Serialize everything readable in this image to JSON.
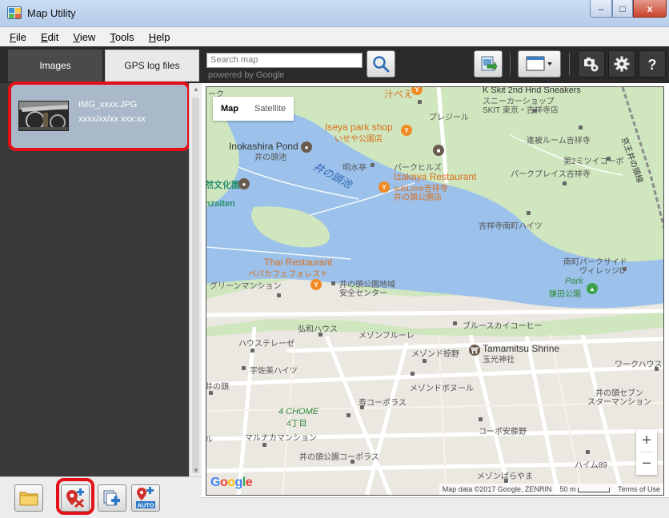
{
  "window": {
    "title": "Map Utility",
    "minimize": "–",
    "maximize": "□",
    "close": "x"
  },
  "menu": [
    {
      "label": "File",
      "u": "F",
      "rest": "ile"
    },
    {
      "label": "Edit",
      "u": "E",
      "rest": "dit"
    },
    {
      "label": "View",
      "u": "V",
      "rest": "iew"
    },
    {
      "label": "Tools",
      "u": "T",
      "rest": "ools"
    },
    {
      "label": "Help",
      "u": "H",
      "rest": "elp"
    }
  ],
  "tabs": {
    "images": "Images",
    "gps": "GPS log files"
  },
  "search": {
    "placeholder": "Search map",
    "powered_by": "powered by Google"
  },
  "image_list": [
    {
      "name": "IMG_xxxx.JPG",
      "datetime": "xxxx/xx/xx xxx:xx"
    }
  ],
  "bottom_buttons": {
    "auto_label": "AUTO"
  },
  "map": {
    "type_map": "Map",
    "type_satellite": "Satellite",
    "zoom_in": "+",
    "zoom_out": "−",
    "logo": "Google",
    "attribution": "Map data ©2017 Google, ZENRIN",
    "scale": "50 m",
    "terms": "Terms of Use",
    "labels": {
      "sneakers": "K Skit 2nd Hnd Sneakers",
      "sneakers_jp": "スニーカーショップ",
      "sneakers_jp2": "SKIT 東京・吉祥寺店",
      "pregio": "プレジール",
      "iseya": "Iseya park shop",
      "iseya_jp": "いせや公園店",
      "shindo": "進被ルーム吉祥寺",
      "inokashira_pond": "Inokashira Pond",
      "inokashira_pond_jp": "井の頭池",
      "meisuitei": "明水亭",
      "park_hills": "パークヒルズ",
      "mitsui": "第2ミツイコーポ",
      "park_place": "パークプレイス吉祥寺",
      "izakaya": "Izakaya Restaurant",
      "izakaya_sub": "subLime吉祥寺",
      "izakaya_jp": "井の頭公園店",
      "pond_big": "井の頭池",
      "nature_center": "然文化園",
      "zaiten": "nzaiten",
      "kichijoji_heights": "吉祥寺南町ハイツ",
      "thai": "Thai Restaurant",
      "thai_jp": "ペパカフェフォレスト",
      "green_mansion": "グリーンマンション",
      "safety_center": "井の頭公園地域",
      "safety_center2": "安全センター",
      "minamicho_side": "南町パークサイド",
      "village_d": "ヴィレッジD",
      "park": "Park",
      "kamata_park": "鎌田公園",
      "blue_sky": "ブルースカイコーヒー",
      "kowa_house": "弘和ハウス",
      "maison_flure": "メゾンフルーレ",
      "house_tele": "ハウステレーゼ",
      "maison_tsubaki": "メゾンド椋野",
      "tamamitsu": "Tamamitsu Shrine",
      "tamamitsu_jp": "玉光神社",
      "work_house": "ワークハウス",
      "usami_heights": "宇佐美ハイツ",
      "inokashira_left": "井の頭",
      "maison_borneur": "メゾンドボヌール",
      "seven_star": "井の頭セブン",
      "seven_star2": "スターマンション",
      "kotobuki": "寿コーポラス",
      "chome": "4 CHOME",
      "chome_jp": "4丁目",
      "corp_anzo": "コーポ安藤野",
      "maruna": "マルナカマンション",
      "ru": "ル",
      "inokashira_corp": "井の頭公園コーポラス",
      "haim89": "ハイム89",
      "maison_barayama": "メゾンばらやま",
      "keio": "京王井の頭線",
      "top_left": "ーク",
      "top_mid": "汁べえ"
    }
  }
}
